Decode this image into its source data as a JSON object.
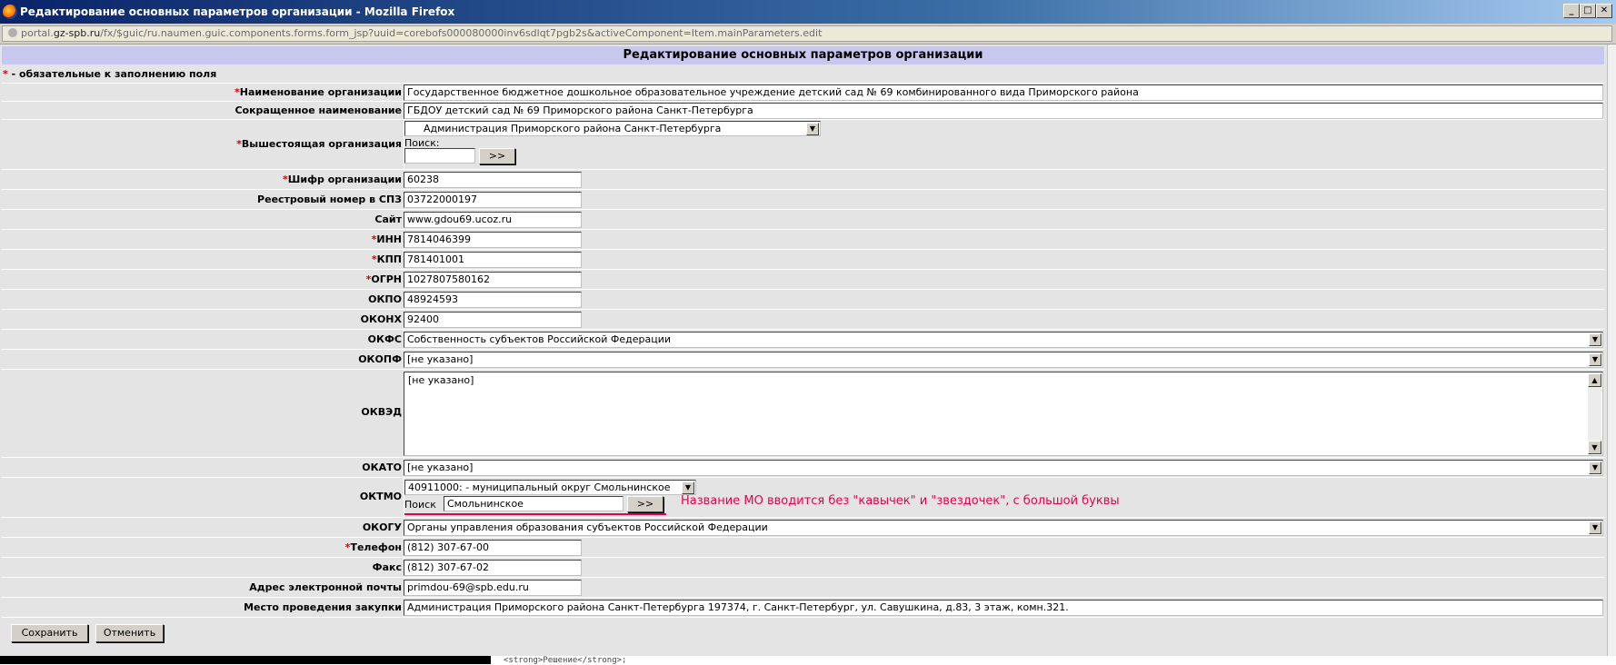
{
  "window": {
    "title": "Редактирование основных параметров организации - Mozilla Firefox",
    "url_prefix": "portal.",
    "url_domain": "gz-spb.ru",
    "url_path": "/fx/$guic/ru.naumen.guic.components.forms.form_jsp?uuid=corebofs000080000inv6sdlqt7pgb2s&activeComponent=Item.mainParameters.edit",
    "controls": {
      "minimize": "_",
      "maximize": "□",
      "close": "✕"
    }
  },
  "form": {
    "header": "Редактирование основных параметров организации",
    "required_note_star": "*",
    "required_note_text": " - обязательные к заполнению поля",
    "required_star": "*",
    "fields": {
      "name": {
        "label": "Наименование организации",
        "value": "Государственное бюджетное дошкольное образовательное учреждение  детский сад № 69 комбинированного вида Приморского района"
      },
      "short_name": {
        "label": "Сокращенное наименование",
        "value": "ГБДОУ детский сад № 69 Приморского района Санкт-Петербурга"
      },
      "parent_org": {
        "label": "Вышестоящая организация",
        "value": "Администрация Приморского района Санкт-Петербурга",
        "search_label": "Поиск:",
        "search_value": "",
        "search_button": ">>"
      },
      "code": {
        "label": "Шифр организации",
        "value": "60238"
      },
      "registry": {
        "label": "Реестровый номер в СПЗ",
        "value": "03722000197"
      },
      "site": {
        "label": "Сайт",
        "value": "www.gdou69.ucoz.ru"
      },
      "inn": {
        "label": "ИНН",
        "value": "7814046399"
      },
      "kpp": {
        "label": "КПП",
        "value": "781401001"
      },
      "ogrn": {
        "label": "ОГРН",
        "value": "1027807580162"
      },
      "okpo": {
        "label": "ОКПО",
        "value": "48924593"
      },
      "okonh": {
        "label": "ОКОНХ",
        "value": "92400"
      },
      "okfs": {
        "label": "ОКФС",
        "value": "Собственность субъектов Российской Федерации"
      },
      "okopf": {
        "label": "ОКОПФ",
        "value": "[не указано]"
      },
      "okved": {
        "label": "ОКВЭД",
        "value": "[не указано]"
      },
      "okato": {
        "label": "ОКАТО",
        "value": "[не указано]"
      },
      "oktmo": {
        "label": "ОКТМО",
        "value": "40911000: - муниципальный округ Смольнинское",
        "search_label": "Поиск",
        "search_value": "Смольнинское",
        "search_button": ">>"
      },
      "okogu": {
        "label": "ОКОГУ",
        "value": "Органы управления образования субъектов Российской Федерации"
      },
      "phone": {
        "label": "Телефон",
        "value": "(812) 307-67-00"
      },
      "fax": {
        "label": "Факс",
        "value": "(812) 307-67-02"
      },
      "email": {
        "label": "Адрес электронной почты",
        "value": "primdou-69@spb.edu.ru"
      },
      "place": {
        "label": "Место проведения закупки",
        "value": "Администрация Приморского района Санкт-Петербурга 197374,  г. Санкт-Петербург, ул. Савушкина, д.83, 3 этаж, комн.321."
      }
    },
    "annotation": "Название МО вводится без \"кавычек\" и \"звездочек\", с большой буквы",
    "buttons": {
      "save": "Сохранить",
      "cancel": "Отменить"
    }
  },
  "background_snippet": "<strong>Решение</strong>;",
  "colors": {
    "header_bg": "#c8c8ee",
    "form_bg": "#e4e4e4",
    "required": "#d40000",
    "annotation": "#e8004c"
  }
}
